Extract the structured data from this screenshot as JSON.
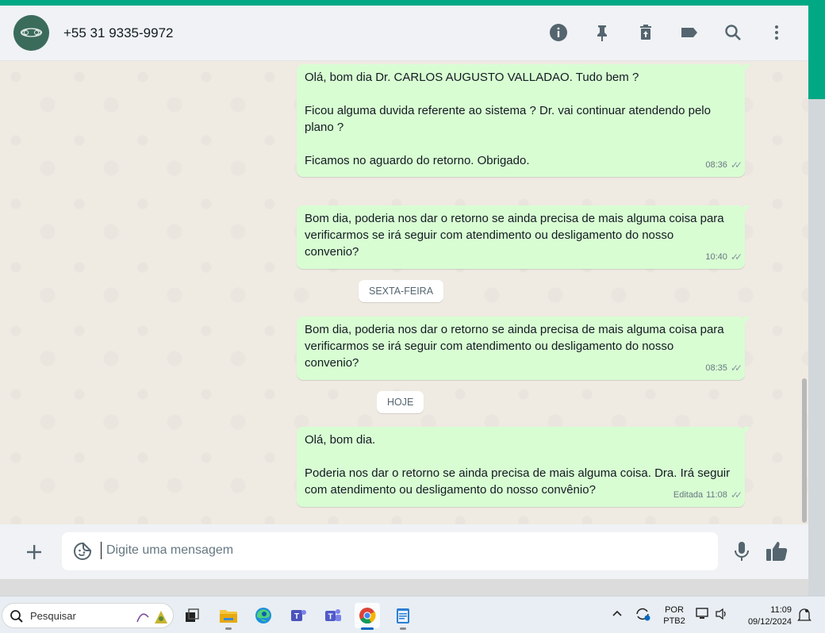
{
  "header": {
    "contact_name": "+55 31 9335-9972",
    "icons": [
      "info-icon",
      "pin-icon",
      "delete-icon",
      "label-icon",
      "search-icon",
      "menu-icon"
    ]
  },
  "messages": [
    {
      "lines": [
        "Olá, bom dia Dr. CARLOS AUGUSTO VALLADAO. Tudo bem ?",
        "",
        "Ficou alguma duvida referente ao sistema ? Dr. vai continuar atendendo pelo",
        "plano ?",
        "",
        "Ficamos no aguardo do retorno. Obrigado."
      ],
      "edited": "",
      "time": "08:36"
    },
    {
      "lines": [
        "Bom dia, poderia nos dar o retorno se ainda precisa de mais alguma coisa para",
        "verificarmos se irá seguir com atendimento ou desligamento do nosso",
        "convenio?"
      ],
      "edited": "",
      "time": "10:40"
    },
    {
      "lines": [
        "Bom dia, poderia nos dar o retorno se ainda precisa de mais alguma coisa para",
        "verificarmos se irá seguir com atendimento ou desligamento do nosso",
        "convenio?"
      ],
      "edited": "",
      "time": "08:35"
    },
    {
      "lines": [
        "Olá, bom dia.",
        "",
        "Poderia nos dar o retorno se ainda precisa de mais alguma coisa. Dra. Irá seguir",
        "com atendimento ou desligamento do nosso convênio?"
      ],
      "edited": "Editada",
      "time": "11:08"
    }
  ],
  "date_chips": [
    "SEXTA-FEIRA",
    "HOJE"
  ],
  "composer": {
    "placeholder": "Digite uma mensagem"
  },
  "taskbar": {
    "search_placeholder": "Pesquisar",
    "lang_top": "POR",
    "lang_bottom": "PTB2",
    "time": "11:09",
    "date": "09/12/2024"
  },
  "colors": {
    "accent": "#00a884",
    "outgoing_bubble": "#d9fdd3",
    "chat_bg": "#efeae2"
  }
}
